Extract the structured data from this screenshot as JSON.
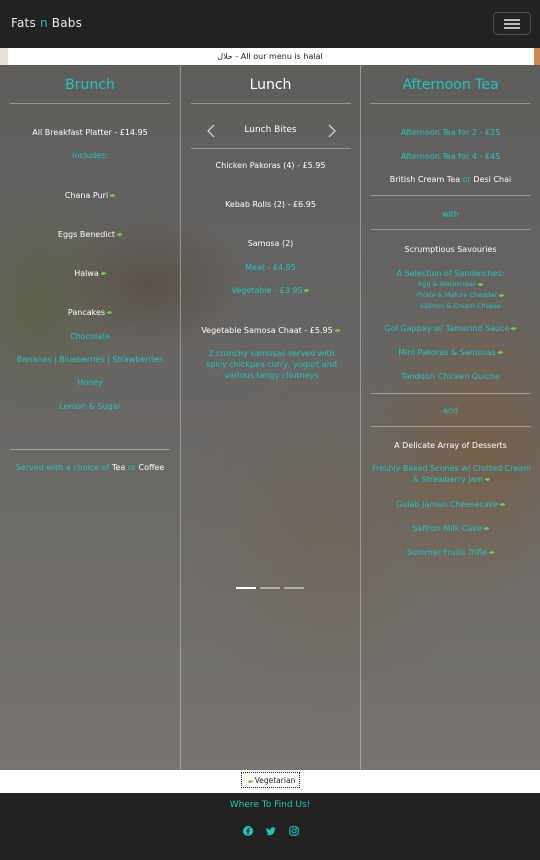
{
  "navbar": {
    "brand_left": "Fats ",
    "brand_mid": "n",
    "brand_right": " Babs",
    "toggle_icon": "hamburger-icon"
  },
  "banner": {
    "text": "حلال - All our menu is halal"
  },
  "brunch": {
    "title": "Brunch",
    "items": [
      "All Breakfast Platter - £14.95",
      "Includes:",
      "Chana Puri",
      "Eggs Benedict",
      "Halwa",
      "Pancakes",
      "Chocolate",
      "Bananas | Blueberries | Strawberries",
      "Honey",
      "Lemon & Sugar"
    ],
    "served_prefix": "Served with a choice of ",
    "served_tea": "Tea",
    "served_or": " or ",
    "served_coffee": "Coffee"
  },
  "lunch": {
    "title": "Lunch",
    "subtitle": "Lunch Bites",
    "items": [
      "Chicken Pakoras (4) - £5.95",
      "Kebab Rolls (2) - £6.95",
      "Samosa (2)",
      "Meat - £4.95",
      "Vegetable - £3.95",
      "Vegetable Samosa Chaat - £5.95"
    ],
    "description": "2 crunchy samosas served with spicy chickpea curry, yogurt and various tangy chutneys"
  },
  "afternoon_tea": {
    "title": "Afternoon Tea",
    "price_2": "Afternoon Tea for 2 - £25",
    "price_4": "Afternoon Tea for 4 - £45",
    "drink_a": "British Cream Tea",
    "drink_or": " or ",
    "drink_b": "Desi Chai",
    "with": "with",
    "savouries_title": "Scrumptious Savouries",
    "sandwiches_title": "A Selection of Sandwiches:",
    "sandwiches": [
      "Egg & Watercress",
      "Pickle & Mature Chedder",
      "Salmon & Cream Cheese"
    ],
    "savouries": [
      "Gol Gappay w/ Tamarind Sauce",
      "Mini Pakoras & Samosas",
      "Tandoori Chicken Quiche"
    ],
    "and": "and",
    "desserts_title": "A Delicate Array of Desserts",
    "desserts": [
      "Freshly Baked Scones w/ Clotted Cream & Strawberry Jam",
      "Gulab Jaman Cheesecake",
      "Saffron Milk Cake",
      "Summer Fruits Trifle"
    ]
  },
  "carousel": {
    "prev_icon": "chevron-left-icon",
    "next_icon": "chevron-right-icon",
    "active_index": 0,
    "count": 3
  },
  "legend": {
    "label": "Vegetarian",
    "icon": "leaf-icon"
  },
  "footer": {
    "title": "Where To Find Us!",
    "icons": [
      "facebook-icon",
      "twitter-icon",
      "instagram-icon"
    ]
  },
  "colors": {
    "accent": "#1fc7c0",
    "navbar": "#222222",
    "veg": "#6fcf3f"
  }
}
